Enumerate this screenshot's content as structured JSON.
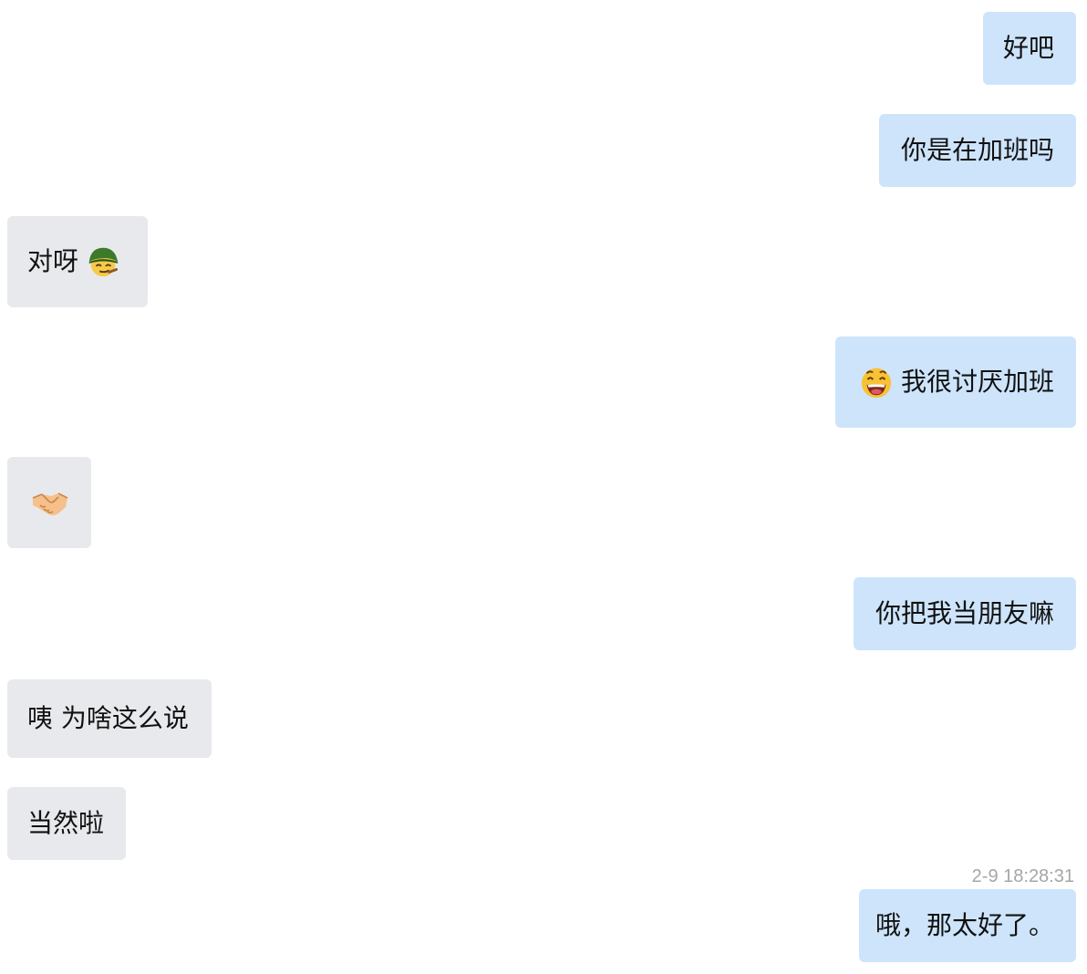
{
  "messages": [
    {
      "side": "outgoing",
      "text": "好吧"
    },
    {
      "side": "outgoing",
      "text": "你是在加班吗"
    },
    {
      "side": "incoming",
      "text": "对呀",
      "emoji": "soldier-helmet-smirk-emoji"
    },
    {
      "side": "outgoing",
      "text": "我很讨厌加班",
      "emoji": "grinning-face-emoji"
    },
    {
      "side": "incoming",
      "text": "",
      "emoji": "handshake-emoji"
    },
    {
      "side": "outgoing",
      "text": "你把我当朋友嘛"
    },
    {
      "side": "incoming",
      "text": "咦 为啥这么说"
    },
    {
      "side": "incoming",
      "text": "当然啦"
    },
    {
      "side": "outgoing",
      "text": "哦，那太好了。"
    }
  ],
  "timestamp": "2-9 18:28:31",
  "colors": {
    "outgoing_bubble": "#cde4fb",
    "incoming_bubble": "#e8e9ec",
    "text": "#111111",
    "timestamp": "#a6a6a6",
    "background": "#ffffff"
  }
}
